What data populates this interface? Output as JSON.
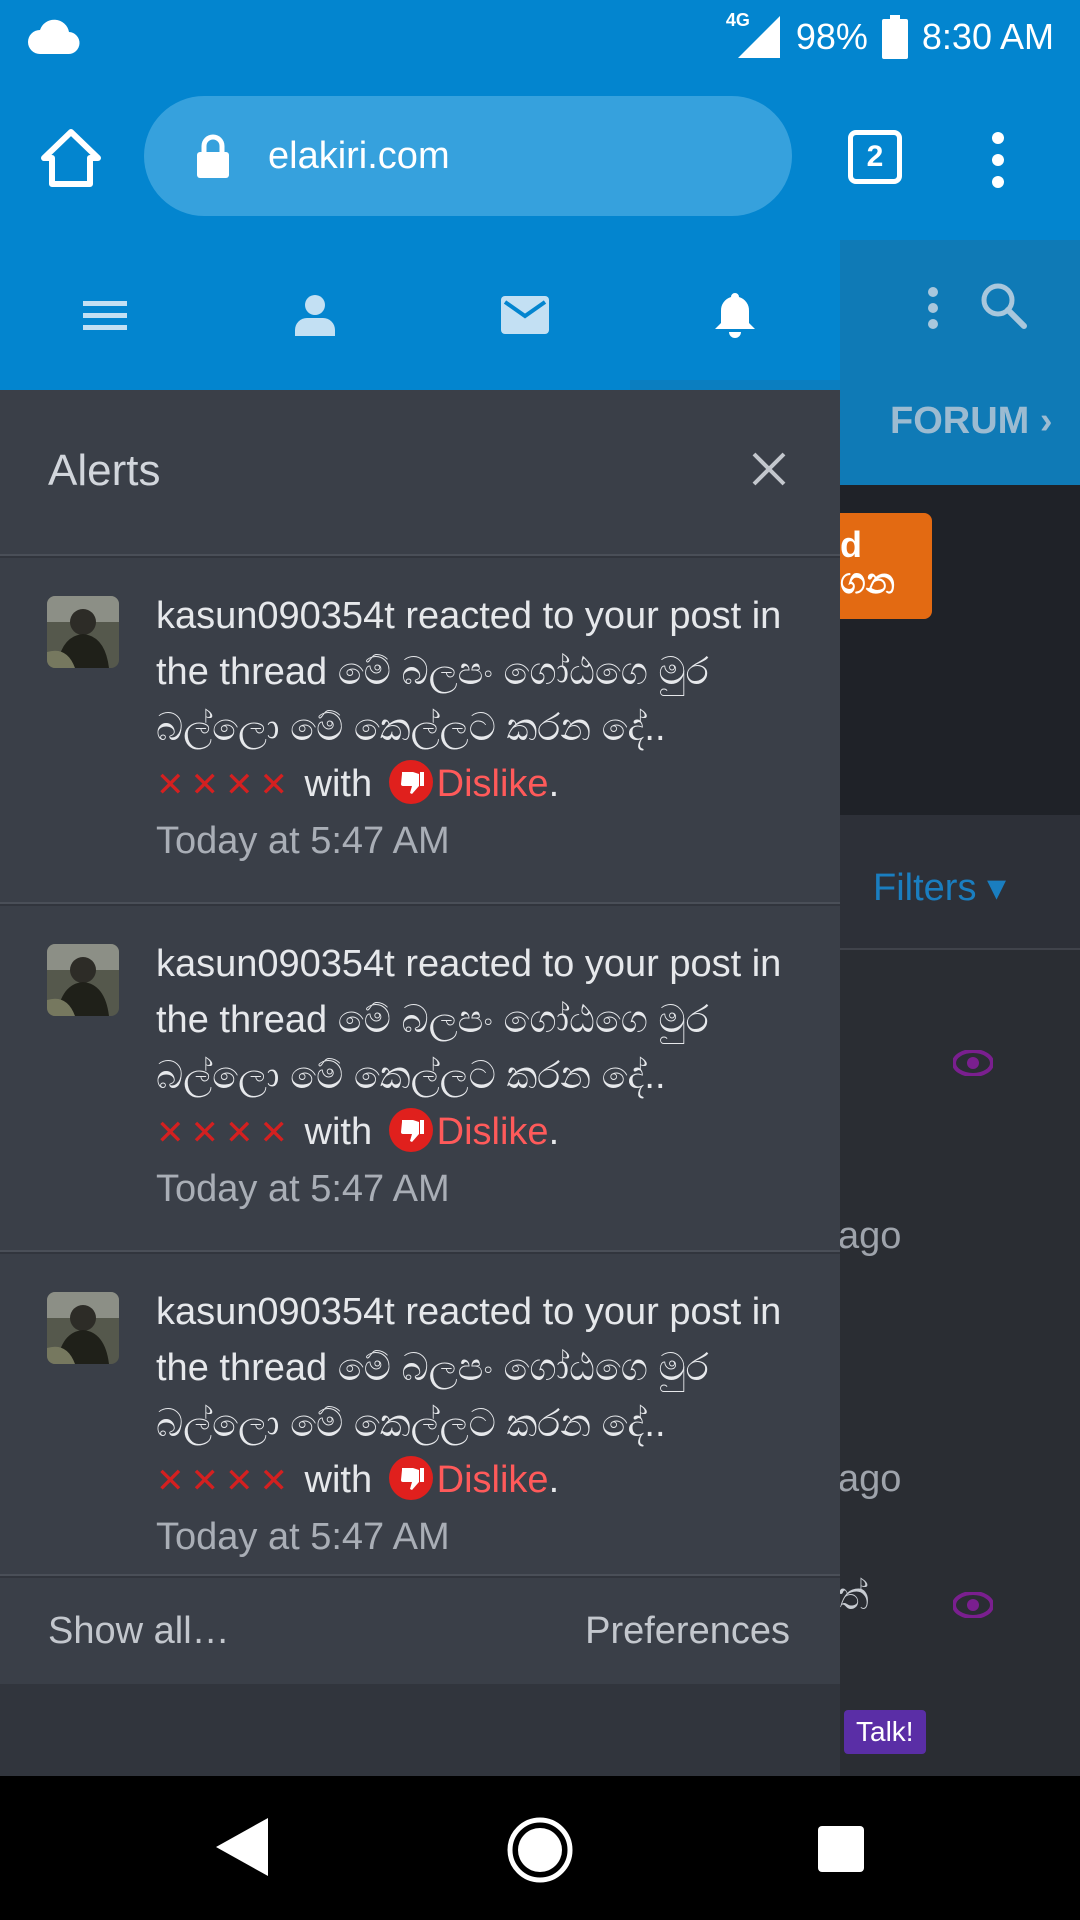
{
  "status_bar": {
    "network": "4G",
    "battery": "98%",
    "time": "8:30 AM"
  },
  "browser": {
    "url": "elakiri.com",
    "tab_count": "2"
  },
  "background_page": {
    "forums_label": "FORUM",
    "banner_text_1": "d",
    "banner_text_2": "ගන",
    "filters_label": "Filters ▾",
    "ago_1": "ago",
    "ago_2": "ago",
    "sinhala_fragment": "ත්",
    "talk_label": "Talk!"
  },
  "drawer": {
    "tabs": [
      "menu",
      "account",
      "inbox",
      "alerts"
    ],
    "alerts_title": "Alerts",
    "alerts": [
      {
        "user": "kasun090354t",
        "text": " reacted to your post in the thread මේ බලපං ගෝඨගෙ මුර බල්ලො මේ කෙල්ලට කරන දේ.. ",
        "crosses": "✕✕✕✕",
        "with": " with ",
        "reaction": "Dislike",
        "time": "Today at 5:47 AM"
      },
      {
        "user": "kasun090354t",
        "text": " reacted to your post in the thread මේ බලපං ගෝඨගෙ මුර බල්ලො මේ කෙල්ලට කරන දේ.. ",
        "crosses": "✕✕✕✕",
        "with": " with ",
        "reaction": "Dislike",
        "time": "Today at 5:47 AM"
      },
      {
        "user": "kasun090354t",
        "text": " reacted to your post in the thread මේ බලපං ගෝඨගෙ මුර බල්ලො මේ කෙල්ලට කරන දේ.. ",
        "crosses": "✕✕✕✕",
        "with": " with ",
        "reaction": "Dislike",
        "time": "Today at 5:47 AM"
      }
    ],
    "show_all": "Show all…",
    "preferences": "Preferences"
  },
  "colors": {
    "browser_blue": "#0385cf",
    "drawer_bg": "#3a3f48",
    "dislike_red": "#ff5a5a"
  }
}
